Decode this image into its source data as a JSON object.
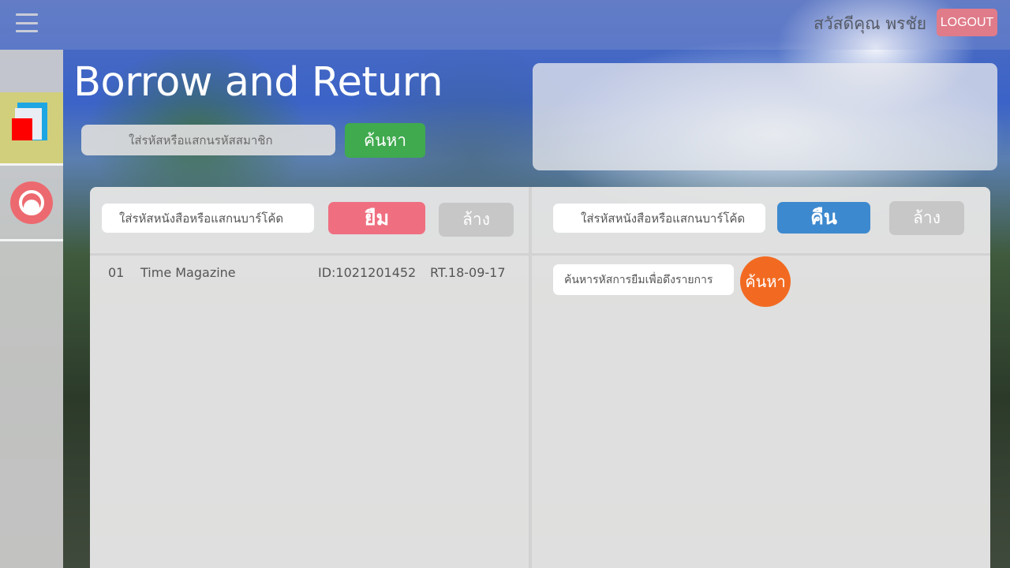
{
  "header": {
    "greeting": "สวัสดีคุณ พรชัย",
    "logout_label": "LOGOUT"
  },
  "sidebar": {
    "items": [
      {
        "name": "books",
        "icon": "books-icon",
        "active": true
      },
      {
        "name": "return",
        "icon": "return-icon",
        "active": false
      }
    ]
  },
  "page": {
    "title": "Borrow and Return",
    "member_placeholder": "ใส่รหัสหรือแสกนรหัสสมาชิก",
    "search_label": "ค้นหา"
  },
  "borrow": {
    "input_placeholder": "ใส่รหัสหนังสือหรือแสกนบาร์โค้ด",
    "borrow_label": "ยืม",
    "clear_label": "ล้าง",
    "items": [
      {
        "no": "01",
        "title": "Time Magazine",
        "id": "ID:1021201452",
        "rt": "RT.18-09-17"
      }
    ]
  },
  "return": {
    "input_placeholder": "ใส่รหัสหนังสือหรือแสกนบาร์โค้ด",
    "return_label": "คืน",
    "clear_label": "ล้าง",
    "txn_placeholder": "ค้นหารหัสการยืมเพื่อดึงรายการ",
    "txn_search_label": "ค้นหา"
  },
  "colors": {
    "logout": "#e07b8a",
    "search": "#3faa4e",
    "borrow": "#ef6f80",
    "return": "#3d89cf",
    "txn_search": "#f26a21",
    "clear": "#c7c7c7"
  }
}
